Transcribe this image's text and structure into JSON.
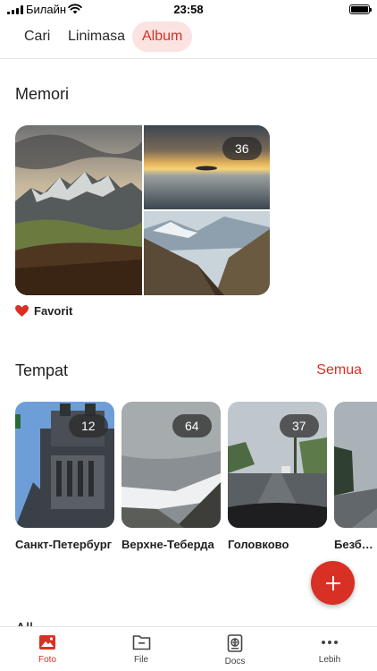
{
  "status_bar": {
    "carrier": "Билайн",
    "time": "23:58"
  },
  "tabs": [
    {
      "label": "Cari",
      "active": false
    },
    {
      "label": "Linimasa",
      "active": false
    },
    {
      "label": "Album",
      "active": true
    }
  ],
  "memori": {
    "title": "Memori",
    "count": "36",
    "favorite_label": "Favorit"
  },
  "tempat": {
    "title": "Tempat",
    "see_all": "Semua",
    "places": [
      {
        "name": "Санкт-Петербург",
        "count": "12"
      },
      {
        "name": "Верхне-Теберда",
        "count": "64"
      },
      {
        "name": "Головково",
        "count": "37"
      },
      {
        "name": "Безбородово",
        "count": ""
      }
    ]
  },
  "all_section": {
    "title": "All"
  },
  "bottom_nav": [
    {
      "label": "Foto",
      "icon": "photo-icon",
      "active": true
    },
    {
      "label": "File",
      "icon": "folder-icon",
      "active": false
    },
    {
      "label": "Docs",
      "icon": "docs-icon",
      "active": false
    },
    {
      "label": "Lebih",
      "icon": "more-icon",
      "active": false
    }
  ],
  "colors": {
    "accent": "#d93025",
    "active_tab_bg": "#fbe3e1",
    "heart": "#d93025"
  }
}
